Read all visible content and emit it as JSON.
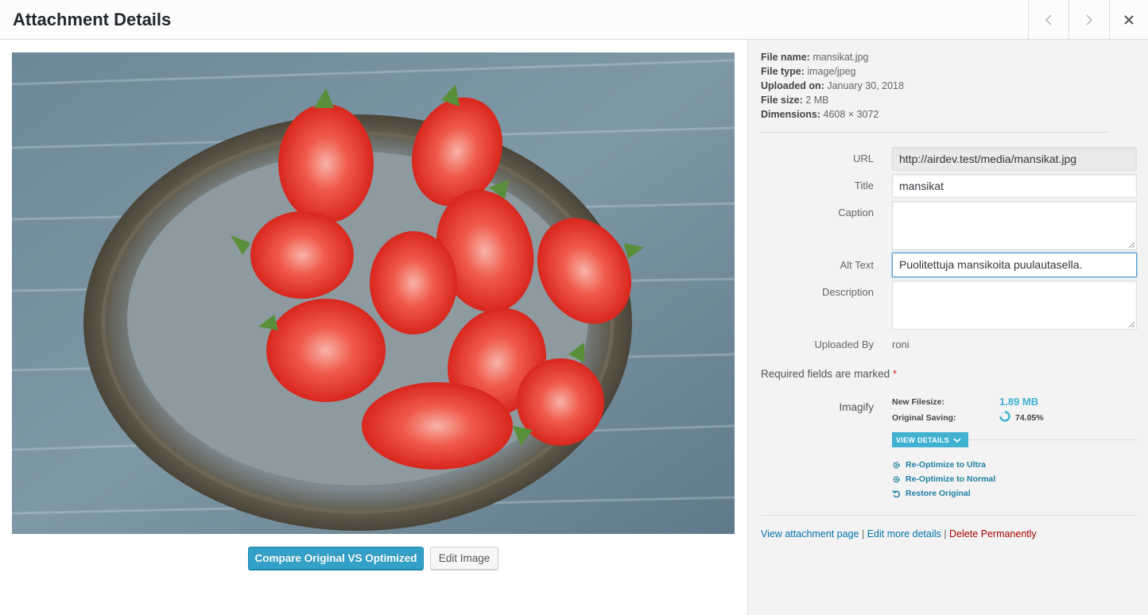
{
  "header": {
    "title": "Attachment Details"
  },
  "nav": {
    "prev_icon": "chevron-left-icon",
    "next_icon": "chevron-right-icon",
    "close_icon": "close-icon"
  },
  "file_info": {
    "name_label": "File name:",
    "name": "mansikat.jpg",
    "type_label": "File type:",
    "type": "image/jpeg",
    "uploaded_label": "Uploaded on:",
    "uploaded": "January 30, 2018",
    "size_label": "File size:",
    "size": "2 MB",
    "dimensions_label": "Dimensions:",
    "dimensions": "4608 × 3072"
  },
  "fields": {
    "url_label": "URL",
    "url_value": "http://airdev.test/media/mansikat.jpg",
    "title_label": "Title",
    "title_value": "mansikat",
    "caption_label": "Caption",
    "caption_value": "",
    "alt_label": "Alt Text",
    "alt_value": "Puolitettuja mansikoita puulautasella.",
    "description_label": "Description",
    "description_value": "",
    "uploaded_by_label": "Uploaded By",
    "uploaded_by_value": "roni"
  },
  "required_note": {
    "text": "Required fields are marked",
    "star": "*"
  },
  "imagify": {
    "label": "Imagify",
    "new_filesize_label": "New Filesize:",
    "new_filesize": "1.89 MB",
    "original_saving_label": "Original Saving:",
    "original_saving": "74.05%",
    "original_saving_fraction": 0.7405,
    "view_details": "VIEW DETAILS",
    "reoptimize_ultra": "Re-Optimize to Ultra",
    "reoptimize_normal": "Re-Optimize to Normal",
    "restore": "Restore Original",
    "accent_color": "#40b1d0"
  },
  "links": {
    "view_page": "View attachment page",
    "edit_more": "Edit more details",
    "delete": "Delete Permanently",
    "separator": "|"
  },
  "media_actions": {
    "compare": "Compare Original VS Optimized",
    "edit_image": "Edit Image"
  }
}
